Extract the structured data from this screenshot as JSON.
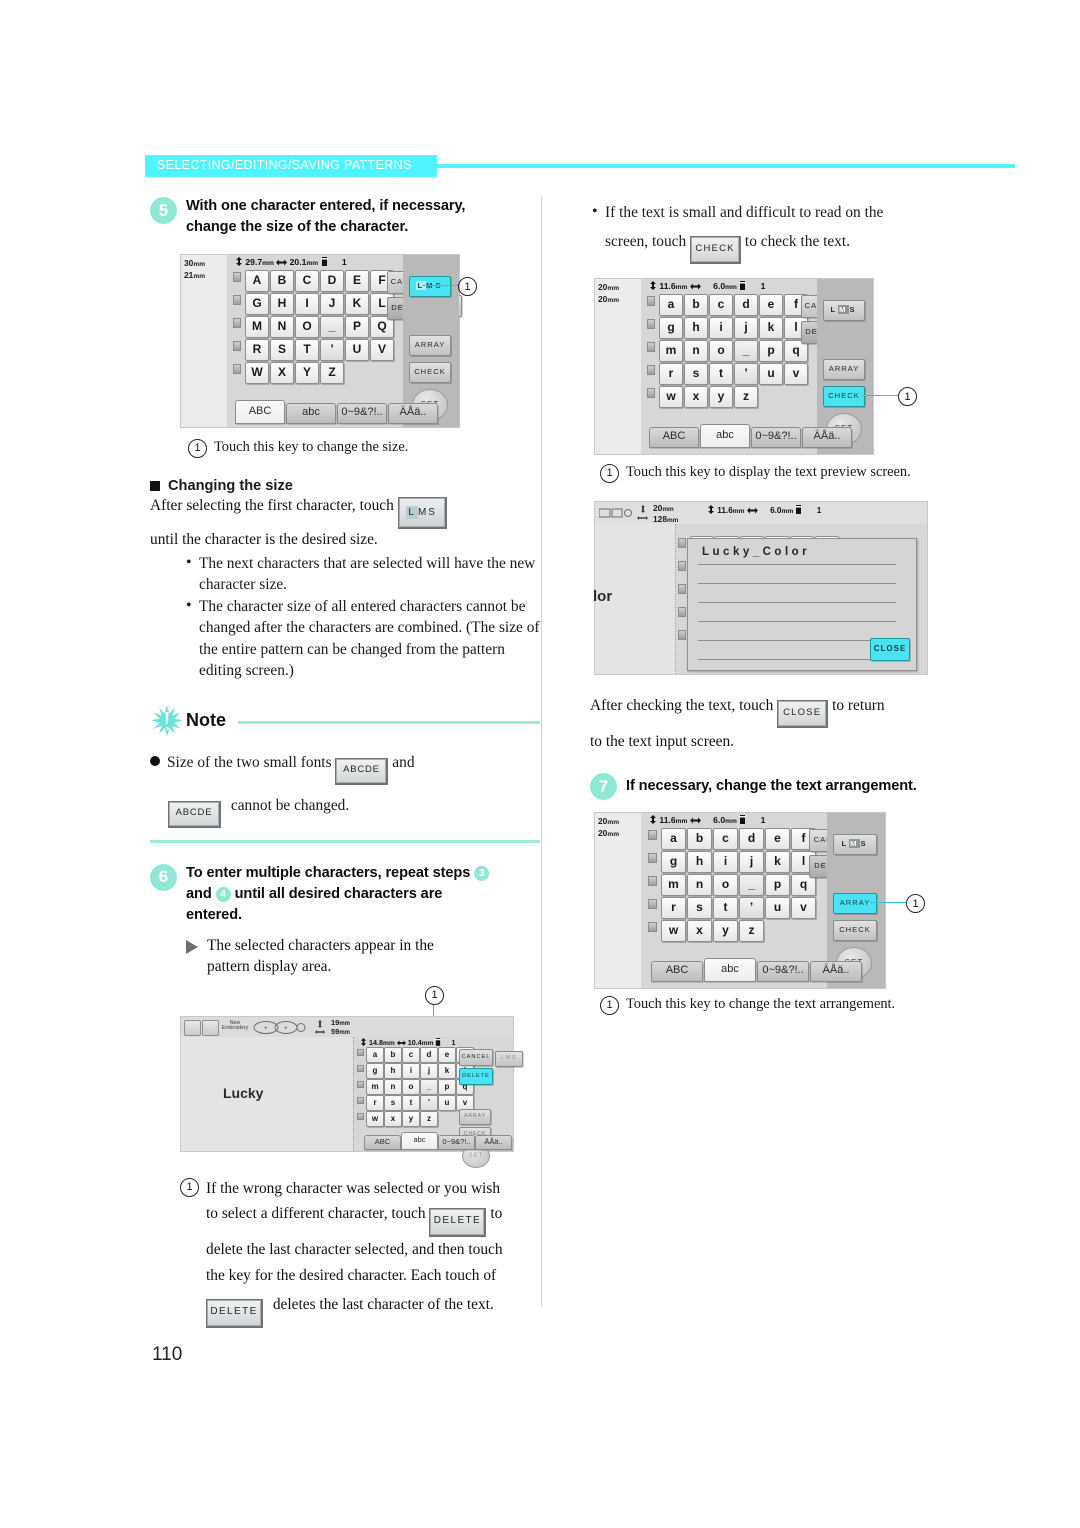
{
  "header": {
    "title": "SELECTING/EDITING/SAVING PATTERNS",
    "accent": "#4ff4ff"
  },
  "page_number": "110",
  "left": {
    "step5": {
      "num": "5",
      "line1": "With one character entered, if necessary,",
      "line2": "change the size of the character."
    },
    "screen1": {
      "size_top": "30",
      "size_top_unit": "mm",
      "size_bottom": "21",
      "size_bottom_unit": "mm",
      "info_height": "29.7",
      "info_width": "20.1",
      "info_unit": "mm",
      "info_count": "1",
      "keys": [
        "A",
        "B",
        "C",
        "D",
        "E",
        "F",
        "G",
        "H",
        "I",
        "J",
        "K",
        "L",
        "M",
        "N",
        "O",
        "_",
        "P",
        "Q",
        "R",
        "S",
        "T",
        "’",
        "U",
        "V",
        "W",
        "X",
        "Y",
        "Z"
      ],
      "cancel": "CANCEL",
      "delete": "DELETE",
      "lms": [
        "L",
        "M",
        "S"
      ],
      "lms_selected": "L",
      "array": "ARRAY",
      "check": "CHECK",
      "set": "SET",
      "tabs": [
        "ABC",
        "abc",
        "0~9&?!..",
        "ÄÅä.."
      ],
      "active_tab": "ABC",
      "callout": "1"
    },
    "caption1": {
      "num": "1",
      "text": "Touch this key to change the size."
    },
    "changing": {
      "heading": "Changing the size",
      "line_a": "After selecting the first character, touch",
      "chip_lms": [
        "L",
        "M",
        "S"
      ],
      "line_b": "until the character is the desired size.",
      "bullets": [
        "The next characters that are selected will have the new character size.",
        "The character size of all entered characters cannot be changed after the characters are combined. (The size of the entire pattern can be changed from the pattern editing screen.)"
      ]
    },
    "note": {
      "title": "Note",
      "text_a": "Size of the two small fonts",
      "chip_a": "ABCDE",
      "text_b": "and",
      "chip_b": "ABCDE",
      "text_c": "cannot be changed."
    },
    "step6": {
      "num": "6",
      "part1": "To enter multiple characters, repeat steps",
      "badge1": "3",
      "part2": "and",
      "badge2": "4",
      "part3": "until all desired characters are",
      "part4": "entered.",
      "arrow_text_1": "The selected characters appear in the",
      "arrow_text_2": "pattern display area."
    },
    "screen2": {
      "pattern_text": "Lucky",
      "toolbar_label": "New Embroidery",
      "dim_w": "19",
      "dim_h": "59",
      "dim_unit": "mm",
      "info_height": "14.8",
      "info_width": "10.4",
      "info_unit": "mm",
      "info_count": "1",
      "keys": [
        "a",
        "b",
        "c",
        "d",
        "e",
        "f",
        "g",
        "h",
        "i",
        "j",
        "k",
        "l",
        "m",
        "n",
        "o",
        "_",
        "p",
        "q",
        "r",
        "s",
        "t",
        "’",
        "u",
        "v",
        "w",
        "x",
        "y",
        "z"
      ],
      "cancel": "CANCEL",
      "delete": "DELETE",
      "lms": [
        "L",
        "M",
        "S"
      ],
      "array": "ARRAY",
      "check": "CHECK",
      "set": "SET",
      "tabs": [
        "ABC",
        "abc",
        "0~9&?!..",
        "ÄÅä.."
      ],
      "active_tab": "abc",
      "callout": "1"
    },
    "caption2": {
      "num": "1",
      "l1": "If the wrong character was selected or you wish",
      "l2a": "to select a different character, touch",
      "chip": "DELETE",
      "l2b": "to",
      "l3": "delete the last character selected, and then touch",
      "l4": "the key for the desired character. Each touch of",
      "l5a": "DELETE",
      "l5b": "deletes the last character of the text."
    }
  },
  "right": {
    "bullet_top": {
      "l1": "If the text is small and difficult to read on the",
      "l2a": "screen, touch",
      "chip": "CHECK",
      "l2b": "to check the text."
    },
    "screen3": {
      "size_top": "20",
      "size_bottom": "20",
      "size_unit": "mm",
      "info_height": "11.6",
      "info_width": "6.0",
      "info_unit": "mm",
      "info_count": "1",
      "keys": [
        "a",
        "b",
        "c",
        "d",
        "e",
        "f",
        "g",
        "h",
        "i",
        "j",
        "k",
        "l",
        "m",
        "n",
        "o",
        "_",
        "p",
        "q",
        "r",
        "s",
        "t",
        "’",
        "u",
        "v",
        "w",
        "x",
        "y",
        "z"
      ],
      "cancel": "CANCEL",
      "delete": "DELETE",
      "lms": [
        "L",
        "M",
        "S"
      ],
      "lms_selected": "M",
      "array": "ARRAY",
      "check": "CHECK",
      "set": "SET",
      "tabs": [
        "ABC",
        "abc",
        "0~9&?!..",
        "ÄÅä.."
      ],
      "active_tab": "abc",
      "callout": "1"
    },
    "caption3": {
      "num": "1",
      "text": "Touch this key to display the text preview screen."
    },
    "screen4": {
      "dim_w": "20",
      "dim_h": "128",
      "dim_unit": "mm",
      "info_height": "11.6",
      "info_width": "6.0",
      "info_unit": "mm",
      "info_count": "1",
      "preview_text": "Lucky_Color",
      "partial_text": "lor",
      "close": "CLOSE"
    },
    "after_check": {
      "l1a": "After checking the text, touch",
      "chip": "CLOSE",
      "l1b": "to return",
      "l2": "to the text input screen."
    },
    "step7": {
      "num": "7",
      "text": "If necessary, change the text arrangement."
    },
    "screen5": {
      "size_top": "20",
      "size_bottom": "20",
      "size_unit": "mm",
      "info_height": "11.6",
      "info_width": "6.0",
      "info_unit": "mm",
      "info_count": "1",
      "keys": [
        "a",
        "b",
        "c",
        "d",
        "e",
        "f",
        "g",
        "h",
        "i",
        "j",
        "k",
        "l",
        "m",
        "n",
        "o",
        "_",
        "p",
        "q",
        "r",
        "s",
        "t",
        "’",
        "u",
        "v",
        "w",
        "x",
        "y",
        "z"
      ],
      "cancel": "CANCEL",
      "delete": "DELETE",
      "lms": [
        "L",
        "M",
        "S"
      ],
      "lms_selected": "M",
      "array": "ARRAY",
      "check": "CHECK",
      "set": "SET",
      "tabs": [
        "ABC",
        "abc",
        "0~9&?!..",
        "ÄÅä.."
      ],
      "active_tab": "abc",
      "callout": "1"
    },
    "caption4": {
      "num": "1",
      "text": "Touch this key to change the text arrangement."
    }
  }
}
